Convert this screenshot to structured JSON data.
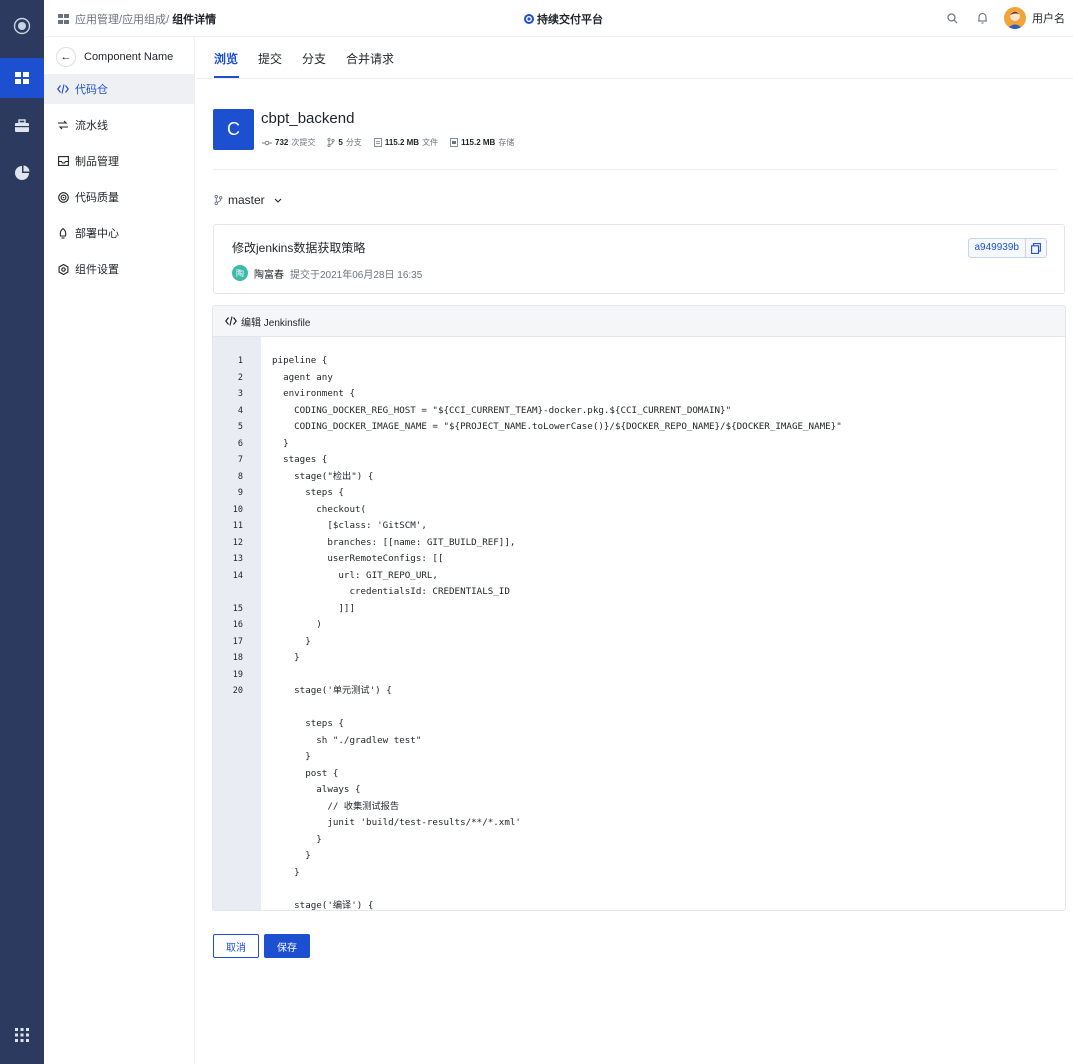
{
  "rail": {
    "items": [
      {
        "icon": "logo-icon"
      },
      {
        "icon": "apps-grid-icon",
        "active": true
      },
      {
        "icon": "briefcase-icon"
      },
      {
        "icon": "pie-chart-icon"
      },
      {
        "icon": "launcher-grid-icon"
      }
    ]
  },
  "header": {
    "breadcrumb": [
      "应用管理",
      "应用组成",
      "组件详情"
    ],
    "breadcrumb_sep": "/",
    "platform": "持续交付平台",
    "user_name": "用户名"
  },
  "sidebar": {
    "back_label": "Component Name",
    "items": [
      {
        "label": "代码仓",
        "icon": "code-icon",
        "active": true
      },
      {
        "label": "流水线",
        "icon": "pipeline-icon"
      },
      {
        "label": "制品管理",
        "icon": "inbox-icon"
      },
      {
        "label": "代码质量",
        "icon": "target-icon"
      },
      {
        "label": "部署中心",
        "icon": "rocket-icon"
      },
      {
        "label": "组件设置",
        "icon": "gear-icon"
      }
    ]
  },
  "tabs": [
    "浏览",
    "提交",
    "分支",
    "合并请求"
  ],
  "repo": {
    "initial": "C",
    "name": "cbpt_backend",
    "stats": [
      {
        "value": "732",
        "unit": "次提交",
        "icon": "commit-icon"
      },
      {
        "value": "5",
        "unit": "分支",
        "icon": "branch-icon"
      },
      {
        "value": "115.2 MB",
        "unit": "文件",
        "icon": "file-icon"
      },
      {
        "value": "115.2 MB",
        "unit": "存储",
        "icon": "storage-icon"
      }
    ]
  },
  "branch": "master",
  "commit": {
    "title": "修改jenkins数据获取策略",
    "author_initial": "陶",
    "author": "陶富春",
    "time": "提交于2021年06月28日 16:35",
    "hash": "a949939b"
  },
  "editor": {
    "title": "编辑 Jenkinsfile",
    "lines": [
      {
        "n": "1",
        "text": "pipeline {"
      },
      {
        "n": "2",
        "text": "  agent any"
      },
      {
        "n": "3",
        "text": "  environment {"
      },
      {
        "n": "4",
        "text": "    CODING_DOCKER_REG_HOST = \"${CCI_CURRENT_TEAM}-docker.pkg.${CCI_CURRENT_DOMAIN}\""
      },
      {
        "n": "5",
        "text": "    CODING_DOCKER_IMAGE_NAME = \"${PROJECT_NAME.toLowerCase()}/${DOCKER_REPO_NAME}/${DOCKER_IMAGE_NAME}\""
      },
      {
        "n": "6",
        "text": "  }"
      },
      {
        "n": "7",
        "text": "  stages {"
      },
      {
        "n": "8",
        "text": "    stage(\"检出\") {"
      },
      {
        "n": "9",
        "text": "      steps {"
      },
      {
        "n": "10",
        "text": "        checkout("
      },
      {
        "n": "11",
        "text": "          [$class: 'GitSCM',"
      },
      {
        "n": "12",
        "text": "          branches: [[name: GIT_BUILD_REF]],"
      },
      {
        "n": "13",
        "text": "          userRemoteConfigs: [["
      },
      {
        "n": "14",
        "text": "            url: GIT_REPO_URL,"
      },
      {
        "n": "",
        "text": "              credentialsId: CREDENTIALS_ID"
      },
      {
        "n": "15",
        "text": "            ]]]"
      },
      {
        "n": "16",
        "text": "        )"
      },
      {
        "n": "17",
        "text": "      }"
      },
      {
        "n": "18",
        "text": "    }"
      },
      {
        "n": "19",
        "text": ""
      },
      {
        "n": "20",
        "text": "    stage('单元测试') {"
      },
      {
        "n": "",
        "text": ""
      },
      {
        "n": "",
        "text": "      steps {"
      },
      {
        "n": "",
        "text": "        sh \"./gradlew test\""
      },
      {
        "n": "",
        "text": "      }"
      },
      {
        "n": "",
        "text": "      post {"
      },
      {
        "n": "",
        "text": "        always {"
      },
      {
        "n": "",
        "text": "          // 收集测试报告"
      },
      {
        "n": "",
        "text": "          junit 'build/test-results/**/*.xml'"
      },
      {
        "n": "",
        "text": "        }"
      },
      {
        "n": "",
        "text": "      }"
      },
      {
        "n": "",
        "text": "    }"
      },
      {
        "n": "",
        "text": ""
      },
      {
        "n": "",
        "text": "    stage('编译') {"
      }
    ]
  },
  "actions": {
    "cancel": "取消",
    "save": "保存"
  },
  "colors": {
    "primary": "#1d4fd1",
    "rail": "#2b3a5e"
  }
}
